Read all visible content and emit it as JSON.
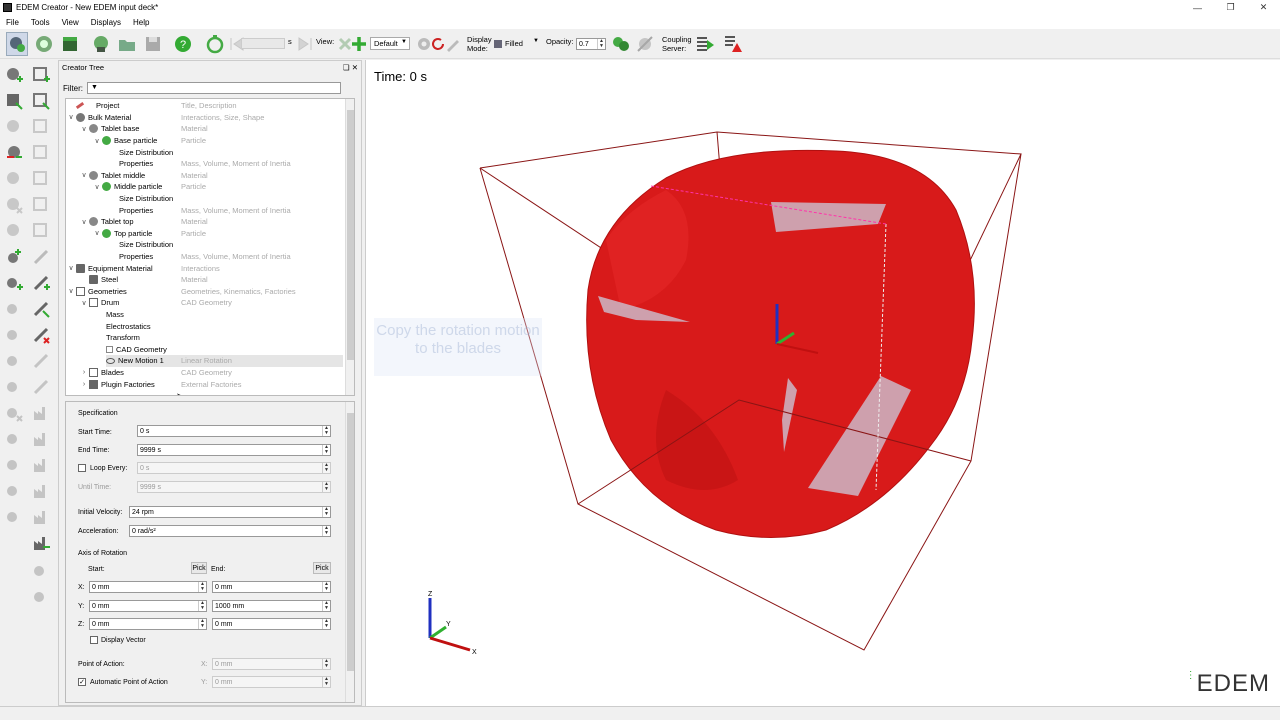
{
  "window": {
    "title": "EDEM Creator - New EDEM input deck*"
  },
  "menu": [
    "File",
    "Tools",
    "View",
    "Displays",
    "Help"
  ],
  "toolbar": {
    "time_unit": "s",
    "view_label": "View:",
    "view_select": "Default",
    "display_mode_label1": "Display",
    "display_mode_label2": "Mode:",
    "display_mode_value": "Filled",
    "opacity_label": "Opacity:",
    "opacity_value": "0.7",
    "coupling_label1": "Coupling",
    "coupling_label2": "Server:"
  },
  "creator_tree": {
    "title": "Creator Tree",
    "filter_label": "Filter:",
    "rows": [
      {
        "name": "Project",
        "desc": "Title, Description"
      },
      {
        "name": "Bulk Material",
        "desc": "Interactions, Size, Shape"
      },
      {
        "name": "Tablet base",
        "desc": "Material"
      },
      {
        "name": "Base particle",
        "desc": "Particle"
      },
      {
        "name": "Size Distribution",
        "desc": ""
      },
      {
        "name": "Properties",
        "desc": "Mass, Volume, Moment of Inertia"
      },
      {
        "name": "Tablet middle",
        "desc": "Material"
      },
      {
        "name": "Middle particle",
        "desc": "Particle"
      },
      {
        "name": "Size Distribution",
        "desc": ""
      },
      {
        "name": "Properties",
        "desc": "Mass, Volume, Moment of Inertia"
      },
      {
        "name": "Tablet top",
        "desc": "Material"
      },
      {
        "name": "Top particle",
        "desc": "Particle"
      },
      {
        "name": "Size Distribution",
        "desc": ""
      },
      {
        "name": "Properties",
        "desc": "Mass, Volume, Moment of Inertia"
      },
      {
        "name": "Equipment Material",
        "desc": "Interactions"
      },
      {
        "name": "Steel",
        "desc": "Material"
      },
      {
        "name": "Geometries",
        "desc": "Geometries, Kinematics, Factories"
      },
      {
        "name": "Drum",
        "desc": "CAD Geometry"
      },
      {
        "name": "Mass",
        "desc": ""
      },
      {
        "name": "Electrostatics",
        "desc": ""
      },
      {
        "name": "Transform",
        "desc": ""
      },
      {
        "name": "CAD Geometry",
        "desc": ""
      },
      {
        "name": "New Motion 1",
        "desc": "Linear Rotation"
      },
      {
        "name": "Blades",
        "desc": "CAD Geometry"
      },
      {
        "name": "Plugin Factories",
        "desc": "External Factories"
      }
    ]
  },
  "spec": {
    "title": "Specification",
    "start_time_label": "Start Time:",
    "start_time": "0 s",
    "end_time_label": "End Time:",
    "end_time": "9999 s",
    "loop_every_label": "Loop Every:",
    "loop_every": "0 s",
    "until_time_label": "Until Time:",
    "until_time": "9999 s",
    "initial_velocity_label": "Initial Velocity:",
    "initial_velocity": "24 rpm",
    "acceleration_label": "Acceleration:",
    "acceleration": "0 rad/s²",
    "axis_title": "Axis of Rotation",
    "start_label": "Start:",
    "end_label": "End:",
    "pick": "Pick",
    "x_label": "X:",
    "y_label": "Y:",
    "z_label": "Z:",
    "start_x": "0 mm",
    "start_y": "0 mm",
    "start_z": "0 mm",
    "end_x": "0 mm",
    "end_y": "1000 mm",
    "end_z": "0 mm",
    "display_vector": "Display Vector",
    "point_of_action": "Point of Action:",
    "poa_x": "0 mm",
    "poa_y": "0 mm",
    "auto_point": "Automatic Point of Action"
  },
  "viewport": {
    "time_label": "Time: 0 s",
    "overlay_text": "Copy the rotation motion to the blades",
    "axes": {
      "x": "X",
      "y": "Y",
      "z": "Z"
    },
    "logo": "EDEM",
    "colors": {
      "drum": "#d81a1a",
      "box": "#7a1010",
      "blade": "#c8b8c8"
    }
  }
}
